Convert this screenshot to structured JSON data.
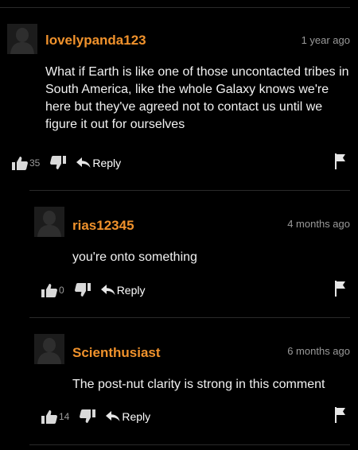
{
  "comments": [
    {
      "username": "lovelypanda123",
      "timestamp": "1 year ago",
      "body": "What if Earth is like one of those uncontacted tribes in South America, like the whole Galaxy knows we're here but they've agreed not to contact us until we figure it out for ourselves",
      "likes": "35",
      "reply_label": "Reply"
    },
    {
      "username": "rias12345",
      "timestamp": "4 months ago",
      "body": "you're onto something",
      "likes": "0",
      "reply_label": "Reply"
    },
    {
      "username": "Scienthusiast",
      "timestamp": "6 months ago",
      "body": "The post-nut clarity is strong in this comment",
      "likes": "14",
      "reply_label": "Reply"
    }
  ],
  "colors": {
    "username": "#f0922c",
    "background": "#000000",
    "muted": "#9a9a9a"
  }
}
